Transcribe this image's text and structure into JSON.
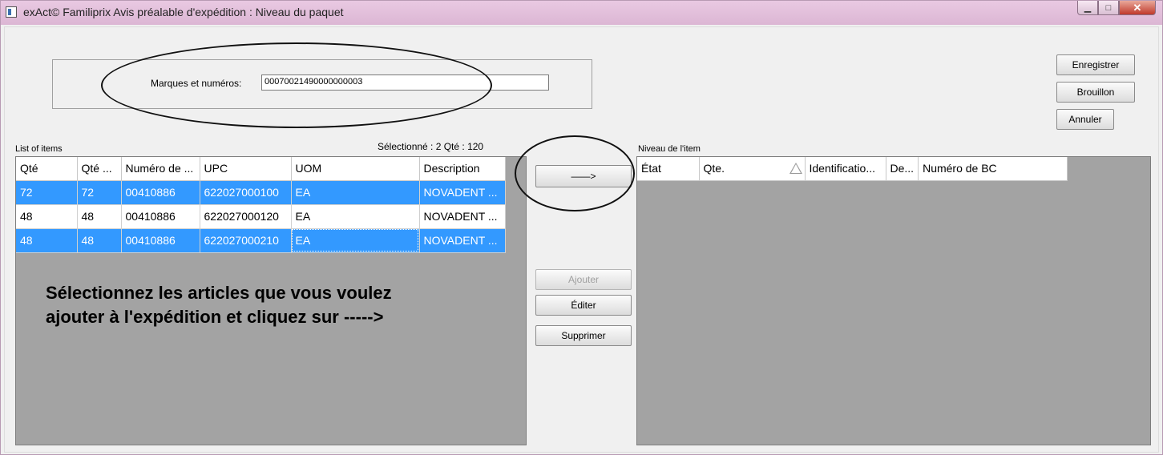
{
  "window": {
    "title": "exAct© Familiprix Avis préalable d'expédition : Niveau du paquet",
    "controls": {
      "minimize": "▁",
      "maximize": "□",
      "close": "✕"
    }
  },
  "header": {
    "marks_label": "Marques et numéros:",
    "marks_value": "00070021490000000003"
  },
  "actions": {
    "save": "Enregistrer",
    "draft": "Brouillon",
    "cancel": "Annuler",
    "transfer": "——>",
    "add": "Ajouter",
    "edit": "Éditer",
    "delete": "Supprimer"
  },
  "items": {
    "title": "List of items",
    "selection_summary": "Sélectionné : 2 Qté : 120",
    "columns": [
      "Qté",
      "Qté ...",
      "Numéro de ...",
      "UPC",
      "UOM",
      "Description"
    ],
    "rows": [
      {
        "selected": true,
        "cells": [
          "72",
          "72",
          "00410886",
          "622027000100",
          "EA",
          "NOVADENT ..."
        ]
      },
      {
        "selected": false,
        "cells": [
          "48",
          "48",
          "00410886",
          "622027000120",
          "EA",
          "NOVADENT ..."
        ]
      },
      {
        "selected": true,
        "cells": [
          "48",
          "48",
          "00410886",
          "622027000210",
          "EA",
          "NOVADENT ..."
        ]
      }
    ],
    "instruction_line1": "Sélectionnez les articles que vous voulez",
    "instruction_line2": "ajouter à l'expédition et cliquez sur ----->"
  },
  "item_level": {
    "title": "Niveau de l'item",
    "columns": [
      "État",
      "Qte.",
      "Identificatio...",
      "De...",
      "Numéro de BC"
    ]
  },
  "colors": {
    "selection": "#3399ff",
    "grid_background": "#a3a3a3",
    "titlebar": "#dcb6d4"
  }
}
